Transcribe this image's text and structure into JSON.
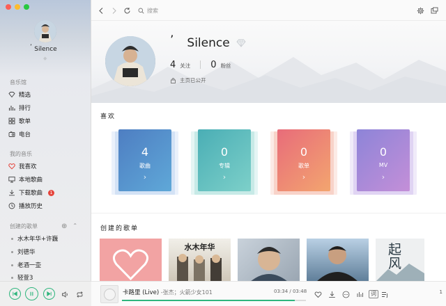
{
  "sidebar": {
    "username": "Silence",
    "quote_mark": "’",
    "sections": {
      "music_hall": "音乐馆",
      "my_music": "我的音乐",
      "created_playlists": "创建的歌单"
    },
    "music_hall_items": [
      {
        "label": "精选",
        "icon": "diamond-icon"
      },
      {
        "label": "排行",
        "icon": "bar-chart-icon"
      },
      {
        "label": "歌单",
        "icon": "grid-icon"
      },
      {
        "label": "电台",
        "icon": "radio-icon"
      }
    ],
    "my_music_items": [
      {
        "label": "我喜欢",
        "icon": "heart-icon"
      },
      {
        "label": "本地歌曲",
        "icon": "monitor-icon"
      },
      {
        "label": "下载歌曲",
        "icon": "download-icon",
        "badge": "1"
      },
      {
        "label": "播放历史",
        "icon": "clock-icon"
      }
    ],
    "playlist_actions": {
      "add": "⊕",
      "collapse": "⌃"
    },
    "playlists": [
      "水木年华+许巍",
      "刘德华",
      "老酒一壶",
      "轻萱3"
    ]
  },
  "topbar": {
    "search_placeholder": "搜索"
  },
  "profile": {
    "name": "Silence",
    "quote_mark": "’",
    "follow_count": "4",
    "follow_label": "关注",
    "fans_count": "0",
    "fans_label": "粉丝",
    "privacy_text": "主页已公开"
  },
  "likes": {
    "title": "喜欢",
    "cards": [
      {
        "count": "4",
        "label": "歌曲",
        "arrow": "›",
        "color_from": "#4e7ec2",
        "color_to": "#5fa8d8"
      },
      {
        "count": "0",
        "label": "专辑",
        "arrow": "›",
        "color_from": "#4aaeb5",
        "color_to": "#7dd0c9"
      },
      {
        "count": "0",
        "label": "歌单",
        "arrow": "›",
        "color_from": "#e86c7a",
        "color_to": "#f3a56f"
      },
      {
        "count": "0",
        "label": "MV",
        "arrow": "›",
        "color_from": "#8d84d8",
        "color_to": "#c48fd8"
      }
    ]
  },
  "created": {
    "title": "创建的歌单",
    "covers": [
      {
        "name": "heart-cover",
        "text": ""
      },
      {
        "name": "shuimu-cover",
        "text": "水木年华"
      },
      {
        "name": "liudehua-cover",
        "text": ""
      },
      {
        "name": "portrait-cover",
        "text": ""
      },
      {
        "name": "calligraphy-cover",
        "text": "起风"
      }
    ]
  },
  "player": {
    "song": "卡路里 (Live)",
    "artist": " -张杰；火箭少女101",
    "time": "03:34 / 03:48",
    "progress": 0.94,
    "lyrics_btn": "词",
    "playlist_count": "1"
  },
  "colors": {
    "accent": "#2fb57d",
    "badge": "#e5453c"
  }
}
